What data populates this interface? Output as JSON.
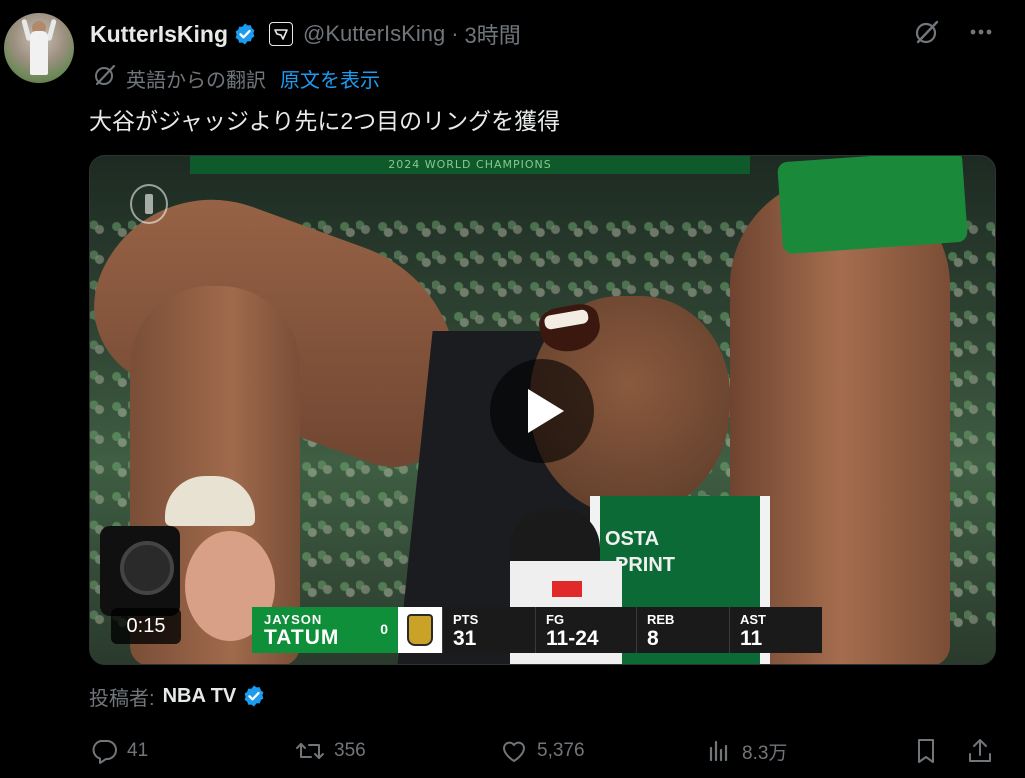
{
  "tweet": {
    "author_name": "KutterIsKing",
    "handle": "@KutterIsKing",
    "separator": "·",
    "time": "3時間",
    "translation_label": "英語からの翻訳",
    "show_original": "原文を表示",
    "text": "大谷がジャッジより先に2つ目のリングを獲得"
  },
  "media": {
    "duration": "0:15",
    "banner_text": "2024 WORLD CHAMPIONS",
    "jersey_line1": "OSTA",
    "jersey_line2": "PRINT",
    "scoreboard": {
      "first_name": "JAYSON",
      "last_name": "TATUM",
      "number": "0",
      "stats": [
        {
          "label": "PTS",
          "value": "31"
        },
        {
          "label": "FG",
          "value": "11-24"
        },
        {
          "label": "REB",
          "value": "8"
        },
        {
          "label": "AST",
          "value": "11"
        }
      ]
    }
  },
  "attribution": {
    "label": "投稿者:",
    "name": "NBA TV"
  },
  "actions": {
    "replies": "41",
    "reposts": "356",
    "likes": "5,376",
    "views": "8.3万"
  },
  "colors": {
    "background": "#000000",
    "text_primary": "#e7e9ea",
    "text_secondary": "#71767b",
    "link": "#1d9bf0",
    "verified": "#1d9bf0",
    "celtics_green": "#0f8f3a"
  },
  "icons": {
    "verified": "verified-badge-icon",
    "affiliate": "affiliate-badge-icon",
    "grok": "grok-icon",
    "more": "more-options-icon",
    "translate": "translate-icon",
    "reply": "reply-icon",
    "repost": "repost-icon",
    "like": "like-icon",
    "views": "views-icon",
    "bookmark": "bookmark-icon",
    "share": "share-icon"
  }
}
